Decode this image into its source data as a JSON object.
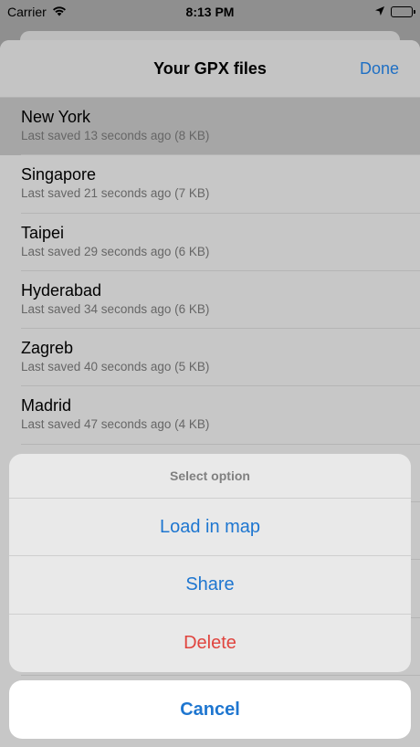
{
  "status_bar": {
    "carrier": "Carrier",
    "time": "8:13 PM",
    "icons": [
      "wifi-icon",
      "location-arrow-icon",
      "battery-icon"
    ]
  },
  "nav": {
    "title": "Your GPX files",
    "done_label": "Done"
  },
  "files": [
    {
      "name": "New York",
      "meta": "Last saved 13 seconds ago (8 KB)"
    },
    {
      "name": "Singapore",
      "meta": "Last saved 21 seconds ago (7 KB)"
    },
    {
      "name": "Taipei",
      "meta": "Last saved 29 seconds ago (6 KB)"
    },
    {
      "name": "Hyderabad",
      "meta": "Last saved 34 seconds ago (6 KB)"
    },
    {
      "name": "Zagreb",
      "meta": "Last saved 40 seconds ago (5 KB)"
    },
    {
      "name": "Madrid",
      "meta": "Last saved 47 seconds ago (4 KB)"
    }
  ],
  "action_sheet": {
    "title": "Select option",
    "load_label": "Load in map",
    "share_label": "Share",
    "delete_label": "Delete",
    "cancel_label": "Cancel"
  },
  "colors": {
    "accent": "#1e76d0",
    "destructive": "#e0443e"
  }
}
